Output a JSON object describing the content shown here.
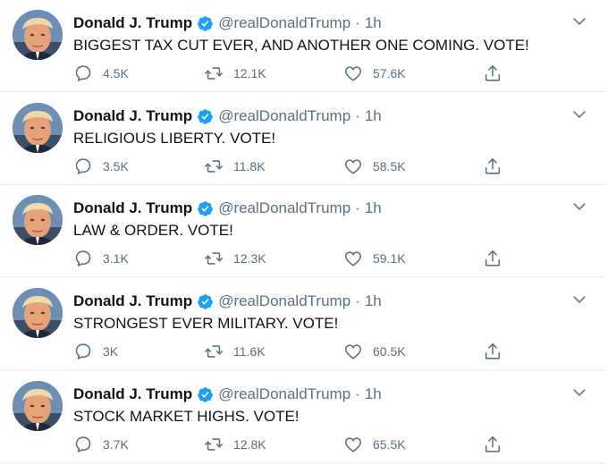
{
  "tweets": [
    {
      "name": "Donald J. Trump",
      "handle": "@realDonaldTrump",
      "separator": "·",
      "time": "1h",
      "text": "BIGGEST TAX CUT EVER, AND ANOTHER ONE COMING. VOTE!",
      "replies": "4.5K",
      "retweets": "12.1K",
      "likes": "57.6K"
    },
    {
      "name": "Donald J. Trump",
      "handle": "@realDonaldTrump",
      "separator": "·",
      "time": "1h",
      "text": "RELIGIOUS LIBERTY. VOTE!",
      "replies": "3.5K",
      "retweets": "11.8K",
      "likes": "58.5K"
    },
    {
      "name": "Donald J. Trump",
      "handle": "@realDonaldTrump",
      "separator": "·",
      "time": "1h",
      "text": "LAW & ORDER. VOTE!",
      "replies": "3.1K",
      "retweets": "12.3K",
      "likes": "59.1K"
    },
    {
      "name": "Donald J. Trump",
      "handle": "@realDonaldTrump",
      "separator": "·",
      "time": "1h",
      "text": "STRONGEST EVER MILITARY. VOTE!",
      "replies": "3K",
      "retweets": "11.6K",
      "likes": "60.5K"
    },
    {
      "name": "Donald J. Trump",
      "handle": "@realDonaldTrump",
      "separator": "·",
      "time": "1h",
      "text": "STOCK MARKET HIGHS. VOTE!",
      "replies": "3.7K",
      "retweets": "12.8K",
      "likes": "65.5K"
    }
  ],
  "icons": {
    "verified": "verified-badge-icon",
    "caret": "chevron-down-icon",
    "reply": "reply-icon",
    "retweet": "retweet-icon",
    "like": "heart-icon",
    "share": "share-icon"
  },
  "colors": {
    "text": "#0f1419",
    "secondary": "#5b7083",
    "verified": "#1da1f2",
    "divider": "#e6ecf0"
  }
}
